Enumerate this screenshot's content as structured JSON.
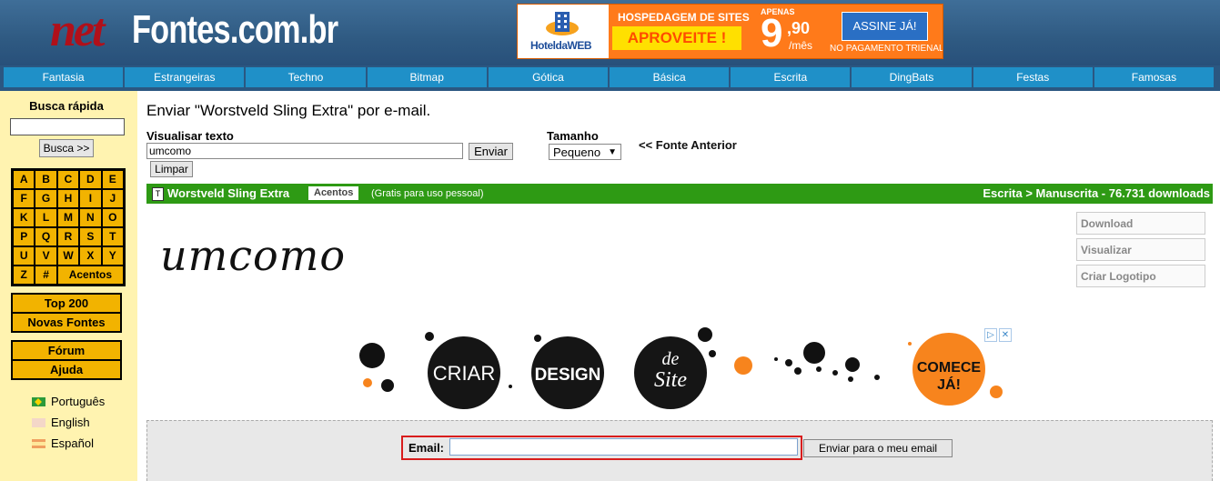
{
  "header": {
    "logo_prefix": "net",
    "logo_text": "Fontes.com.br",
    "banner": {
      "brand": "HoteldaWEB",
      "headline": "HOSPEDAGEM DE SITES",
      "tagline": "APROVEITE !",
      "price_prefix": "APENAS",
      "price_main": "9",
      "price_cents": ",90",
      "price_unit": "/mês",
      "cta": "ASSINE JÁ!",
      "footnote": "NO PAGAMENTO TRIENAL"
    }
  },
  "nav": {
    "items": [
      "Fantasia",
      "Estrangeiras",
      "Techno",
      "Bitmap",
      "Gótica",
      "Básica",
      "Escrita",
      "DingBats",
      "Festas",
      "Famosas"
    ]
  },
  "sidebar": {
    "search_title": "Busca rápida",
    "search_value": "",
    "search_button": "Busca >>",
    "letters": [
      "A",
      "B",
      "C",
      "D",
      "E",
      "F",
      "G",
      "H",
      "I",
      "J",
      "K",
      "L",
      "M",
      "N",
      "O",
      "P",
      "Q",
      "R",
      "S",
      "T",
      "U",
      "V",
      "W",
      "X",
      "Y",
      "Z",
      "#"
    ],
    "accents_label": "Acentos",
    "top200": "Top 200",
    "new_fonts": "Novas Fontes",
    "forum": "Fórum",
    "help": "Ajuda",
    "languages": [
      "Português",
      "English",
      "Español"
    ]
  },
  "main": {
    "title": "Enviar \"Worstveld Sling Extra\" por e-mail.",
    "preview_label": "Visualisar texto",
    "preview_value": "umcomo",
    "send_button": "Enviar",
    "clear_button": "Limpar",
    "size_label": "Tamanho",
    "size_value": "Pequeno",
    "prev_font": "<< Fonte Anterior",
    "font": {
      "name": "Worstveld Sling Extra",
      "accents_tag": "Acentos",
      "license": "(Gratis para uso pessoal)",
      "category": "Escrita > Manuscrita - 76.731 downloads",
      "preview_text": "umcomo"
    },
    "actions": [
      "Download",
      "Visualizar",
      "Criar Logotipo"
    ],
    "ad": {
      "words": [
        "CRIAR",
        "DESIGN",
        "de",
        "Site",
        "COMECE",
        "JÁ!"
      ],
      "close_labels": [
        "▷",
        "✕"
      ]
    },
    "email": {
      "label": "Email:",
      "value": "",
      "button": "Enviar para o meu email"
    }
  }
}
